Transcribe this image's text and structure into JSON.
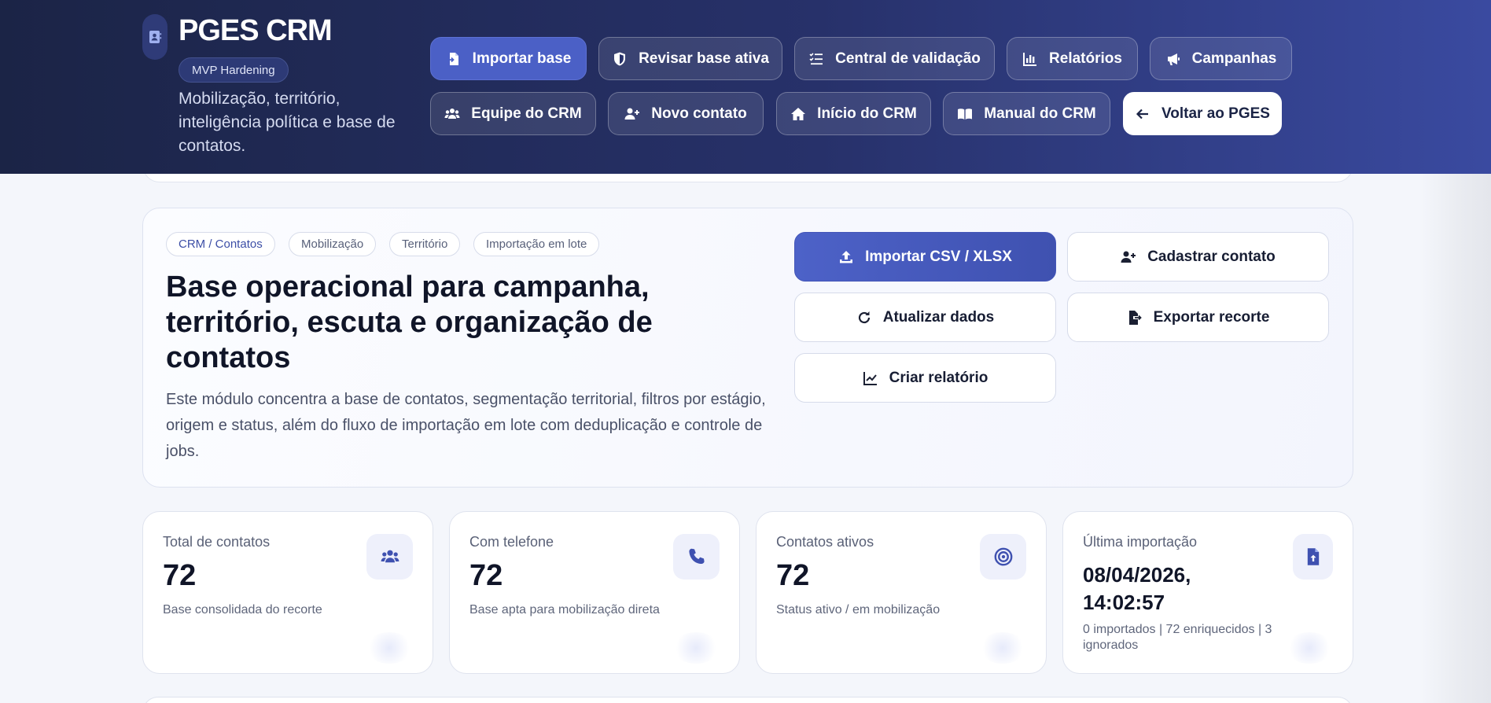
{
  "header": {
    "brand_title": "PGES CRM",
    "brand_badge": "MVP Hardening",
    "brand_desc": "Mobilização, território, inteligência política e base de contatos.",
    "nav": [
      {
        "label": "Importar base",
        "icon": "file-import-icon"
      },
      {
        "label": "Revisar base ativa",
        "icon": "shield-icon"
      },
      {
        "label": "Central de validação",
        "icon": "checklist-icon"
      },
      {
        "label": "Relatórios",
        "icon": "bar-chart-icon"
      },
      {
        "label": "Campanhas",
        "icon": "megaphone-icon"
      },
      {
        "label": "Equipe do CRM",
        "icon": "users-icon"
      },
      {
        "label": "Novo contato",
        "icon": "user-plus-icon"
      },
      {
        "label": "Início do CRM",
        "icon": "home-icon"
      },
      {
        "label": "Manual do CRM",
        "icon": "book-icon"
      },
      {
        "label": "Voltar ao PGES",
        "icon": "arrow-left-icon"
      }
    ]
  },
  "hero": {
    "chips": [
      "CRM / Contatos",
      "Mobilização",
      "Território",
      "Importação em lote"
    ],
    "title": "Base operacional para campanha, território, escuta e organização de contatos",
    "description": "Este módulo concentra a base de contatos, segmentação territorial, filtros por estágio, origem e status, além do fluxo de importação em lote com deduplicação e controle de jobs.",
    "actions": [
      {
        "label": "Importar CSV / XLSX",
        "icon": "upload-icon"
      },
      {
        "label": "Cadastrar contato",
        "icon": "user-plus-icon"
      },
      {
        "label": "Atualizar dados",
        "icon": "refresh-icon"
      },
      {
        "label": "Exportar recorte",
        "icon": "file-export-icon"
      },
      {
        "label": "Criar relatório",
        "icon": "line-chart-icon"
      }
    ]
  },
  "stats": [
    {
      "label": "Total de contatos",
      "value": "72",
      "sub": "Base consolidada do recorte",
      "icon": "users-icon"
    },
    {
      "label": "Com telefone",
      "value": "72",
      "sub": "Base apta para mobilização direta",
      "icon": "phone-icon"
    },
    {
      "label": "Contatos ativos",
      "value": "72",
      "sub": "Status ativo / em mobilização",
      "icon": "target-icon"
    },
    {
      "label": "Última importação",
      "value": "08/04/2026, 14:02:57",
      "sub": "0 importados | 72 enriquecidos | 3 ignorados",
      "icon": "file-upload-icon"
    }
  ],
  "colors": {
    "header_dark": "#1b2446",
    "header_light": "#3a4aa0",
    "accent": "#4b60c6",
    "icon_blue": "#3f51b0"
  }
}
